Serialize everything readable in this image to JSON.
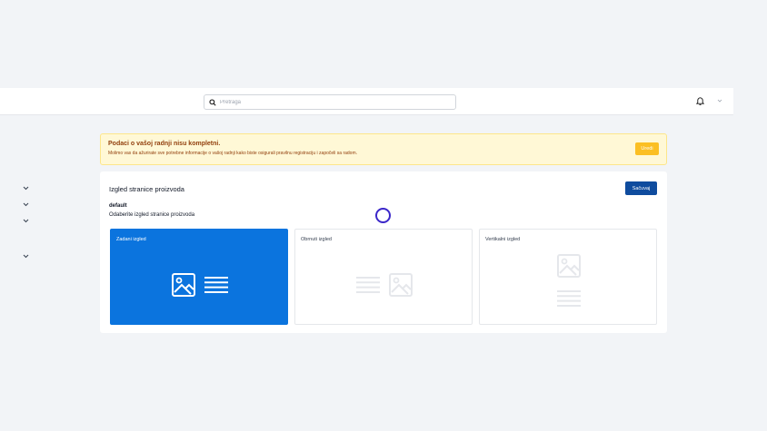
{
  "header": {
    "search_placeholder": "Pretraga",
    "icons": [
      "search-icon",
      "bell-icon",
      "chevron-down-icon"
    ]
  },
  "sidebar": {
    "icons": [
      "chevron-down-icon",
      "chevron-down-icon",
      "chevron-down-icon",
      "chevron-down-icon"
    ]
  },
  "alert": {
    "title": "Podaci o vašoj radnji nisu kompletni.",
    "text": "Molimo vas da ažurirate sve potrebne informacije o vašoj radnji kako biste osigurali pravilnu registraciju i započeli sa radom.",
    "button_label": "Uredi",
    "color": "#fbbf24"
  },
  "settings": {
    "title": "Izgled stranice proizvoda",
    "save_label": "Sačuvaj",
    "field_name": "default",
    "field_description": "Odaberite izgled stranice proizvoda",
    "accent": "#0b74de",
    "options": [
      {
        "label": "Zadani izgled",
        "selected": true,
        "icons": [
          "image-icon",
          "lines-icon"
        ]
      },
      {
        "label": "Obrnuti izgled",
        "selected": false,
        "icons": [
          "lines-icon",
          "image-icon"
        ]
      },
      {
        "label": "Vertikalni izgled",
        "selected": false,
        "icons": [
          "image-icon",
          "lines-icon"
        ]
      }
    ]
  }
}
